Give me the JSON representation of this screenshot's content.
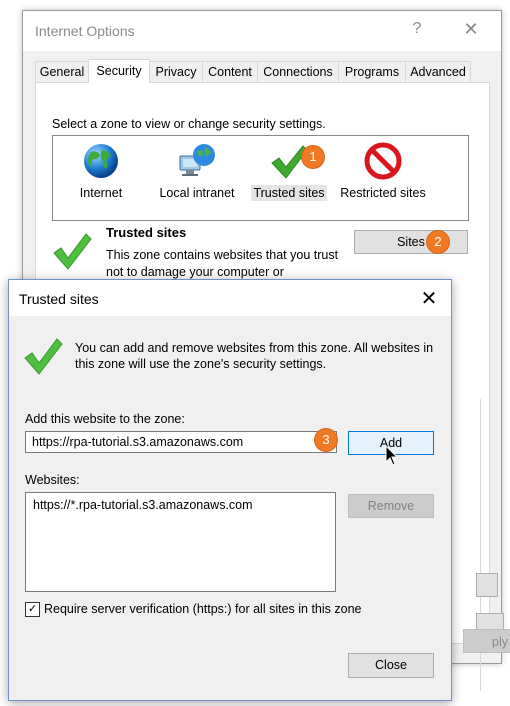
{
  "internet_options": {
    "title": "Internet Options",
    "help_glyph": "?",
    "close_glyph": "✕",
    "tabs": [
      {
        "label": "General"
      },
      {
        "label": "Security"
      },
      {
        "label": "Privacy"
      },
      {
        "label": "Content"
      },
      {
        "label": "Connections"
      },
      {
        "label": "Programs"
      },
      {
        "label": "Advanced"
      }
    ],
    "active_tab": "Security",
    "zone_prompt": "Select a zone to view or change security settings.",
    "zones": [
      {
        "label": "Internet",
        "icon": "globe-icon"
      },
      {
        "label": "Local intranet",
        "icon": "network-globe-icon"
      },
      {
        "label": "Trusted sites",
        "icon": "green-check-icon"
      },
      {
        "label": "Restricted sites",
        "icon": "prohibited-icon"
      }
    ],
    "selected_zone": "Trusted sites",
    "zone_heading": "Trusted sites",
    "zone_description": "This zone contains websites that you trust not to damage your computer or",
    "sites_button": "Sites",
    "apply_fragment": "ply"
  },
  "trusted_sites_dialog": {
    "title": "Trusted sites",
    "close_glyph": "✕",
    "info_text": "You can add and remove websites from this zone. All websites in this zone will use the zone's security settings.",
    "add_label": "Add this website to the zone:",
    "url_value": "https://rpa-tutorial.s3.amazonaws.com",
    "add_button": "Add",
    "websites_label": "Websites:",
    "websites": [
      "https://*.rpa-tutorial.s3.amazonaws.com"
    ],
    "remove_button": "Remove",
    "verify_checked": true,
    "verify_glyph": "✓",
    "verify_label": "Require server verification (https:) for all sites in this zone",
    "close_button": "Close"
  },
  "step_badges": [
    "1",
    "2",
    "3"
  ],
  "colors": {
    "badge": "#ef7a22",
    "check_green": "#3daa2f",
    "accent_border": "#0078d7",
    "prohibited_red": "#d9161c"
  }
}
